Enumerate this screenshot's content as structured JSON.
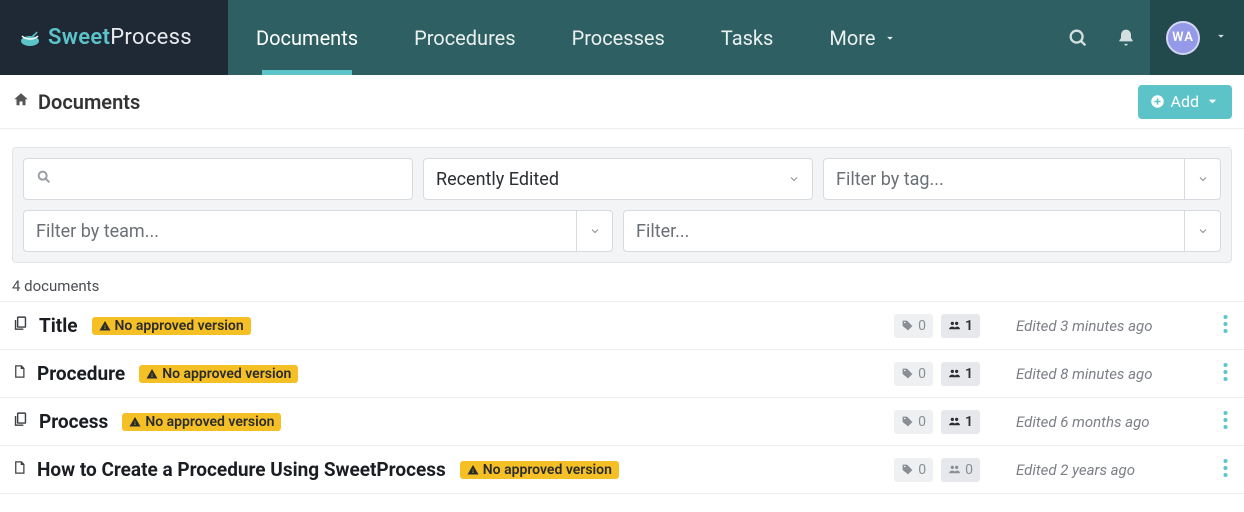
{
  "brand": {
    "accent": "Sweet",
    "rest": "Process"
  },
  "nav": {
    "items": [
      "Documents",
      "Procedures",
      "Processes",
      "Tasks",
      "More"
    ],
    "active_index": 0
  },
  "user": {
    "initials": "WA"
  },
  "page": {
    "title": "Documents",
    "add_label": "Add"
  },
  "filters": {
    "search_placeholder": "",
    "sort": "Recently Edited",
    "tag_placeholder": "Filter by tag...",
    "team_placeholder": "Filter by team...",
    "filter_placeholder": "Filter..."
  },
  "count_label": "4 documents",
  "badge_text": "No approved version",
  "documents": [
    {
      "title": "Title",
      "tags": 0,
      "users": 1,
      "users_muted": false,
      "has_copy_icon": true,
      "edited": "Edited 3 minutes ago"
    },
    {
      "title": "Procedure",
      "tags": 0,
      "users": 1,
      "users_muted": false,
      "has_copy_icon": false,
      "edited": "Edited 8 minutes ago"
    },
    {
      "title": "Process",
      "tags": 0,
      "users": 1,
      "users_muted": false,
      "has_copy_icon": true,
      "edited": "Edited 6 months ago"
    },
    {
      "title": "How to Create a Procedure Using SweetProcess",
      "tags": 0,
      "users": 0,
      "users_muted": true,
      "has_copy_icon": false,
      "edited": "Edited 2 years ago"
    }
  ]
}
